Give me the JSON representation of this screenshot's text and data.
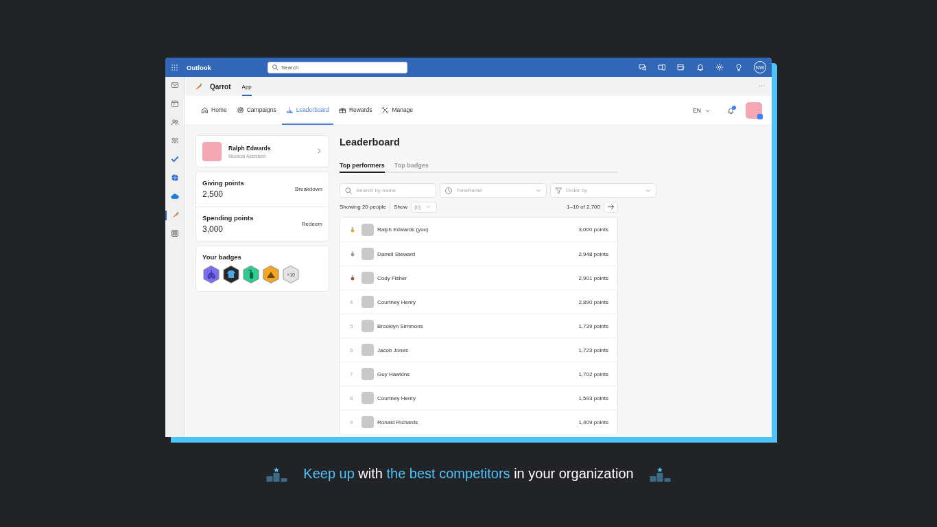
{
  "window": {
    "app_name": "Outlook",
    "search": {
      "placeholder": "Search"
    },
    "account_initials": "NW"
  },
  "rail": [
    {
      "kind": "mail",
      "selected": false
    },
    {
      "kind": "calendar",
      "selected": false
    },
    {
      "kind": "people",
      "selected": false
    },
    {
      "kind": "groups",
      "selected": false
    },
    {
      "kind": "todo",
      "selected": false
    },
    {
      "kind": "office",
      "selected": false
    },
    {
      "kind": "cloud",
      "selected": false
    },
    {
      "kind": "carrot",
      "selected": true
    },
    {
      "kind": "apps",
      "selected": false
    }
  ],
  "app_header": {
    "name": "Qarrot",
    "tabs": [
      {
        "label": "App",
        "selected": true
      }
    ]
  },
  "nav": {
    "items": [
      {
        "kind": "home",
        "label": "Home",
        "selected": false
      },
      {
        "kind": "campaigns",
        "label": "Campaigns",
        "selected": false
      },
      {
        "kind": "leaderboard",
        "label": "Leaderboard",
        "selected": true
      },
      {
        "kind": "rewards",
        "label": "Rewards",
        "selected": false
      },
      {
        "kind": "manage",
        "label": "Manage",
        "selected": false
      }
    ],
    "language": "EN"
  },
  "profile": {
    "name": "Ralph Edwards",
    "role": "Medical Assistant"
  },
  "points": [
    {
      "label": "Giving points",
      "value": "2,500",
      "action": "Breakdown"
    },
    {
      "label": "Spending points",
      "value": "3,000",
      "action": "Redeem"
    }
  ],
  "badges": {
    "title": "Your badges",
    "items": [
      {
        "kind": "lungs",
        "color": "#7b6ff0"
      },
      {
        "kind": "shirt",
        "color": "#25272b"
      },
      {
        "kind": "extinguisher",
        "color": "#2ecc8f"
      },
      {
        "kind": "mountain",
        "color": "#f5a623"
      }
    ],
    "more": "+10"
  },
  "leaderboard": {
    "title": "Leaderboard",
    "tabs": [
      {
        "label": "Top performers",
        "selected": true
      },
      {
        "label": "Top badges",
        "selected": false
      }
    ],
    "search": {
      "placeholder": "Search by name"
    },
    "timeframe": {
      "placeholder": "Timeframe"
    },
    "order": {
      "placeholder": "Order by"
    },
    "showing": "Showing 20 people",
    "show_label": "Show",
    "show_value": {
      "placeholder": "{n}"
    },
    "range": "1–10 of 2,700",
    "rows": [
      {
        "kind": "medal",
        "color": "#e0a82e",
        "name": "Ralph Edwards (you)",
        "points": "3,000 points"
      },
      {
        "kind": "medal",
        "color": "#9a9a9a",
        "name": "Darrell Steward",
        "points": "2,948 points"
      },
      {
        "kind": "medal",
        "color": "#b5561d",
        "name": "Cody Fisher",
        "points": "2,901 points"
      },
      {
        "kind": "rank",
        "rank": "4",
        "name": "Courtney Henry",
        "points": "2,890 points"
      },
      {
        "kind": "rank",
        "rank": "5",
        "name": "Brooklyn Simmons",
        "points": "1,739 points"
      },
      {
        "kind": "rank",
        "rank": "6",
        "name": "Jacob Jones",
        "points": "1,723 points"
      },
      {
        "kind": "rank",
        "rank": "7",
        "name": "Guy Hawkins",
        "points": "1,702 points"
      },
      {
        "kind": "rank",
        "rank": "8",
        "name": "Courtney Henry",
        "points": "1,593 points"
      },
      {
        "kind": "rank",
        "rank": "9",
        "name": "Ronald Richards",
        "points": "1,409 points"
      }
    ]
  },
  "caption": [
    {
      "text": "Keep up",
      "highlight": true
    },
    {
      "text": " with ",
      "highlight": false
    },
    {
      "text": "the best competitors",
      "highlight": true
    },
    {
      "text": " in your organization",
      "highlight": false
    }
  ]
}
